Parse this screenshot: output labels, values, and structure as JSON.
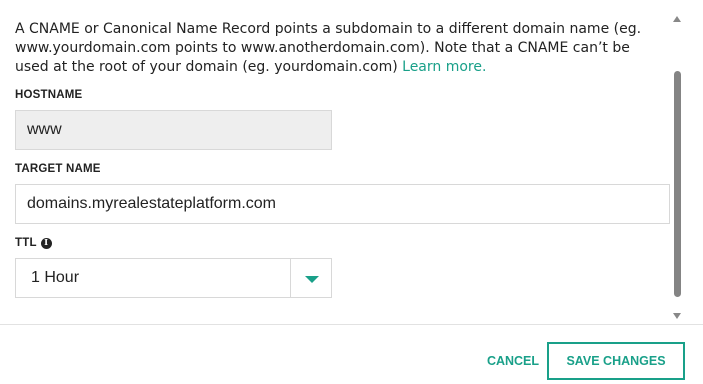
{
  "description": {
    "text": "A CNAME or Canonical Name Record points a subdomain to a different domain name (eg. www.yourdomain.com points to www.anotherdomain.com). Note that a CNAME can’t be used at the root of your domain (eg. yourdomain.com)",
    "link_label": "Learn more."
  },
  "hostname": {
    "label": "HOSTNAME",
    "value": "www"
  },
  "target_name": {
    "label": "TARGET NAME",
    "value": "domains.myrealestateplatform.com"
  },
  "ttl": {
    "label": "TTL",
    "info_icon_glyph": "i",
    "selected": "1 Hour"
  },
  "footer": {
    "cancel_label": "CANCEL",
    "save_label": "SAVE CHANGES"
  },
  "colors": {
    "accent": "#19a089",
    "disabled_field": "#eeeeee",
    "border": "#d8d8d8",
    "scrollbar_thumb": "#848484"
  },
  "icons": {
    "ttl_info": "info-icon",
    "select_caret": "caret-down-icon",
    "scroll_up": "scroll-up-arrow-icon",
    "scroll_down": "scroll-down-arrow-icon"
  }
}
